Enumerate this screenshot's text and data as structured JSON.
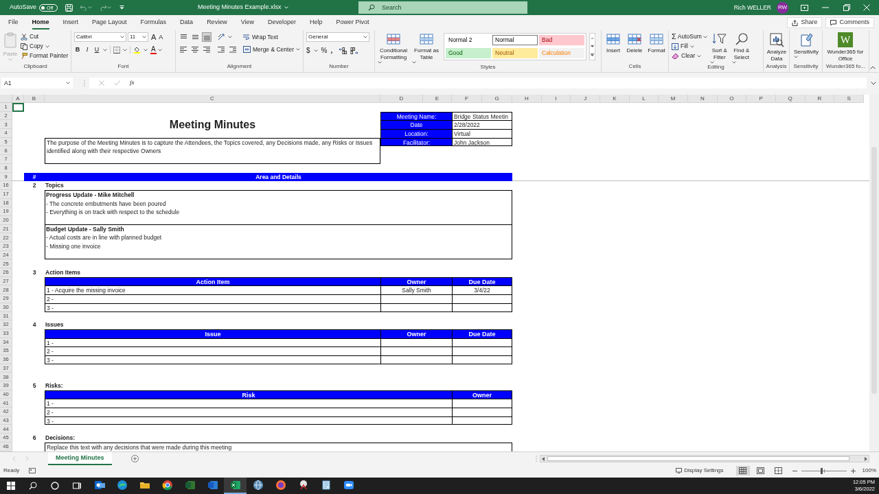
{
  "title_bar": {
    "autosave": {
      "label": "AutoSave",
      "state": "Off",
      "on": false
    },
    "document_title": "Meeting Minutes Example.xlsx",
    "search": {
      "placeholder": "Search"
    },
    "user_name": "Rich WELLER",
    "avatar": "RW"
  },
  "ribbon_tabs": [
    {
      "label": "File",
      "selected": false
    },
    {
      "label": "Home",
      "selected": true
    },
    {
      "label": "Insert",
      "selected": false
    },
    {
      "label": "Page Layout",
      "selected": false
    },
    {
      "label": "Formulas",
      "selected": false
    },
    {
      "label": "Data",
      "selected": false
    },
    {
      "label": "Review",
      "selected": false
    },
    {
      "label": "View",
      "selected": false
    },
    {
      "label": "Developer",
      "selected": false
    },
    {
      "label": "Help",
      "selected": false
    },
    {
      "label": "Power Pivot",
      "selected": false
    }
  ],
  "share_button": "Share",
  "comments_button": "Comments",
  "ribbon": {
    "clipboard": {
      "label": "Clipboard",
      "paste": {
        "label": "Paste",
        "disabled": true
      },
      "cut": "Cut",
      "copy": "Copy",
      "format_painter": "Format Painter"
    },
    "font": {
      "label": "Font",
      "font_name": "Calibri",
      "font_size": "11",
      "grow": "A",
      "shrink": "A",
      "bold": "B",
      "italic": "I",
      "underline": "U",
      "font_color": "A"
    },
    "alignment": {
      "label": "Alignment",
      "vertical": [
        {
          "selected": false
        },
        {
          "selected": false
        },
        {
          "selected": true
        }
      ],
      "wrap_text": "Wrap Text",
      "merge_center": "Merge & Center"
    },
    "number": {
      "label": "Number",
      "format": "General",
      "currency": "$",
      "percent": "%",
      "comma": ","
    },
    "styles": {
      "label": "Styles",
      "conditional_formatting": "Conditional Formatting",
      "format_as_table": "Format as Table",
      "gallery": [
        {
          "label": "Normal 2",
          "color": "#ffffff",
          "selected": false
        },
        {
          "label": "Normal",
          "color": "#ffffff",
          "selected": true
        },
        {
          "label": "Bad",
          "color": "#ffc7ce",
          "selected": false
        },
        {
          "label": "Good",
          "color": "#c6efce",
          "selected": false
        },
        {
          "label": "Neutral",
          "color": "#ffeb9c",
          "selected": false
        },
        {
          "label": "Calculation",
          "color": "#f2f2f2",
          "selected": false
        }
      ]
    },
    "cells": {
      "label": "Cells",
      "insert": "Insert",
      "delete": "Delete",
      "format": "Format"
    },
    "editing": {
      "label": "Editing",
      "autosum_symbol": "Σ",
      "autosum": "AutoSum",
      "fill": "Fill",
      "clear": "Clear",
      "sort_filter": "Sort & Filter",
      "find_select": "Find & Select"
    },
    "analysis": {
      "label": "Analysis",
      "analyze_data": "Analyze Data"
    },
    "sensitivity": {
      "label": "Sensitivity",
      "button": "Sensitivity"
    },
    "addin": {
      "label": "Wunder365 fo...",
      "logo": "W",
      "button": "Wunder365 for Office"
    }
  },
  "formula_bar": {
    "name_box": "A1",
    "fx": "fx"
  },
  "sheet": {
    "columns": [
      "A",
      "B",
      "C",
      "D",
      "E",
      "F",
      "G",
      "H",
      "I",
      "J",
      "K",
      "L",
      "M",
      "N",
      "O",
      "P",
      "Q",
      "R",
      "S"
    ],
    "rows": [
      "1",
      "2",
      "3",
      "4",
      "5",
      "6",
      "7",
      "8",
      "9",
      "16",
      "17",
      "18",
      "19",
      "20",
      "21",
      "22",
      "23",
      "24",
      "25",
      "26",
      "27",
      "28",
      "29",
      "30",
      "31",
      "32",
      "33",
      "34",
      "35",
      "36",
      "37",
      "38",
      "39",
      "40",
      "41",
      "42",
      "43",
      "44",
      "45",
      "46"
    ],
    "title": "Meeting Minutes",
    "purpose": "The purpose of the Meeting Minutes is to capture the Attendees, the Topics covered, any Decisions made, any Risks or Issues identified along with their respective Owners",
    "info": [
      {
        "label": "Meeting Name:",
        "value": "Bridge Status Meetin"
      },
      {
        "label": "Date",
        "value": "2/28/2022"
      },
      {
        "label": "Location:",
        "value": "Virtual"
      },
      {
        "label": "Facilitator:",
        "value": "John Jackson"
      }
    ],
    "area_header": {
      "number": "#",
      "label": "Area and Details"
    },
    "sections": [
      {
        "number": "2",
        "title": "Topics",
        "kind": "topics",
        "blocks": [
          {
            "heading": "Progress Update - Mike Mitchell",
            "lines": [
              "- The concrete embutments have been poured",
              "- Everything is on track with respect to the schedule"
            ]
          },
          {
            "heading": "Budget Update - Sally Smith",
            "lines": [
              "- Actual costs are in line with planned budget",
              "- Missing one invoice"
            ]
          }
        ]
      },
      {
        "number": "3",
        "title": "Action Items",
        "kind": "table",
        "columns": [
          "Action Item",
          "Owner",
          "Due Date"
        ],
        "rows": [
          [
            "1 - Acquire the missing invoice",
            "Sally Smith",
            "3/4/22"
          ],
          [
            "2 -"
          ],
          [
            "3 -"
          ]
        ]
      },
      {
        "number": "4",
        "title": "Issues",
        "kind": "table",
        "columns": [
          "Issue",
          "Owner",
          "Due Date"
        ],
        "rows": [
          [
            "1 -"
          ],
          [
            "2 -"
          ],
          [
            "3 -"
          ]
        ]
      },
      {
        "number": "5",
        "title": "Risks:",
        "kind": "table",
        "columns": [
          "Risk",
          "Owner"
        ],
        "rows": [
          [
            "1 -"
          ],
          [
            "2 -"
          ],
          [
            "3 -"
          ]
        ]
      },
      {
        "number": "6",
        "title": "Decisions:",
        "kind": "text",
        "text": "Replace this text with any decisions that were made during this meeting"
      }
    ]
  },
  "sheet_tabs": [
    {
      "label": "Meeting Minutes",
      "selected": true
    }
  ],
  "status_bar": {
    "ready": "Ready",
    "display_settings": "Display Settings",
    "views": [
      {
        "selected": true
      },
      {
        "selected": false
      },
      {
        "selected": false
      }
    ],
    "zoom_slider": {
      "level": 0.46
    },
    "zoom": "100%"
  },
  "taskbar": {
    "time": "12:05 PM",
    "date": "3/6/2022"
  }
}
